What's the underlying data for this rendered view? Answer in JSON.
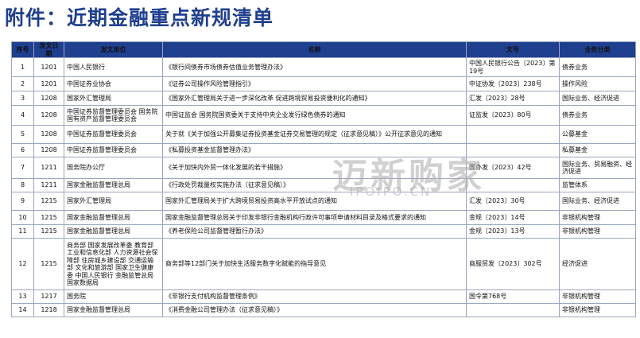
{
  "title": "附件：近期金融重点新规清单",
  "columns": [
    "序号",
    "发文日期",
    "发文单位",
    "名称",
    "文号",
    "业务分类"
  ],
  "rows": [
    {
      "no": "1",
      "date": "1201",
      "issuer": "中国人民银行",
      "name": "《银行间债券市场债券估值业务管理办法》",
      "doc": "中国人民银行公告〔2023〕第19号",
      "cat": "债券业务"
    },
    {
      "no": "2",
      "date": "1201",
      "issuer": "中国证券业协会",
      "name": "《证券公司操作风险管理指引》",
      "doc": "中证协发〔2023〕238号",
      "cat": "操作风险"
    },
    {
      "no": "3",
      "date": "1208",
      "issuer": "国家外汇管理局",
      "name": "《国家外汇管理局关于进一步深化改革 促进跨境贸易投资便利化的通知》",
      "doc": "汇发〔2023〕28号",
      "cat": "国际业务、经济促进"
    },
    {
      "no": "4",
      "date": "1208",
      "issuer": "中国证券监督管理委员会 国务院国有资产监督管理委员会",
      "name": "中国证监会 国务院国资委关于支持中央企业发行绿色债券的通知",
      "doc": "证监发〔2023〕80号",
      "cat": "债券业务"
    },
    {
      "no": "5",
      "date": "1208",
      "issuer": "中国证券监督管理委员会",
      "name": "关于就《关于加强公开募集证券投资基金证券交易管理的规定（征求意见稿）》公开征求意见的通知",
      "doc": "",
      "cat": "公募基金"
    },
    {
      "no": "6",
      "date": "1208",
      "issuer": "中国证券监督管理委员会",
      "name": "《私募投资基金监督管理办法》",
      "doc": "",
      "cat": "私募基金"
    },
    {
      "no": "7",
      "date": "1211",
      "issuer": "国务院办公厅",
      "name": "《关于加快内外贸一体化发展的若干措施》",
      "doc": "国办发〔2023〕42号",
      "cat": "国际业务、贸易融资、经济促进"
    },
    {
      "no": "8",
      "date": "1211",
      "issuer": "国家金融监督管理总局",
      "name": "《行政处罚裁量权实施办法（征求意见稿）》",
      "doc": "",
      "cat": "监管体系"
    },
    {
      "no": "9",
      "date": "1215",
      "issuer": "国家外汇管理局",
      "name": "国家外汇管理局关于扩大跨境贸易投资高水平开放试点的通知",
      "doc": "汇发〔2023〕30号",
      "cat": "国际业务、经济促进"
    },
    {
      "no": "10",
      "date": "1215",
      "issuer": "国家金融监督管理总局",
      "name": "国家金融监督管理总局关于印发非银行金融机构行政许可事项申请材料目录及格式要求的通知",
      "doc": "金规〔2023〕14号",
      "cat": "非银机构管理"
    },
    {
      "no": "11",
      "date": "1215",
      "issuer": "国家金融监督管理总局",
      "name": "《养老保险公司监督管理暂行办法》",
      "doc": "金规〔2023〕13号",
      "cat": "非银机构管理"
    },
    {
      "no": "12",
      "date": "1215",
      "issuer": "商务部 国家发展改革委 教育部 工业和信息化部 人力资源社会保障部 住房城乡建设部 交通运输部 文化和旅游部 国家卫生健康委 中国人民银行 金融监管总局 国家数据局",
      "name": "商务部等12部门关于加快生活服务数字化赋能的指导意见",
      "doc": "商服贸发〔2023〕302号",
      "cat": "经济促进"
    },
    {
      "no": "13",
      "date": "1217",
      "issuer": "国务院",
      "name": "《非银行支付机构监督管理条例》",
      "doc": "国令第768号",
      "cat": "非银机构管理"
    },
    {
      "no": "14",
      "date": "1218",
      "issuer": "国家金融监督管理总局",
      "name": "《消费金融公司管理办法（征求意见稿）》",
      "doc": "",
      "cat": "非银机构管理"
    }
  ],
  "watermark": {
    "main": "迈新购家",
    "sub": "IPOIPO.CN"
  }
}
